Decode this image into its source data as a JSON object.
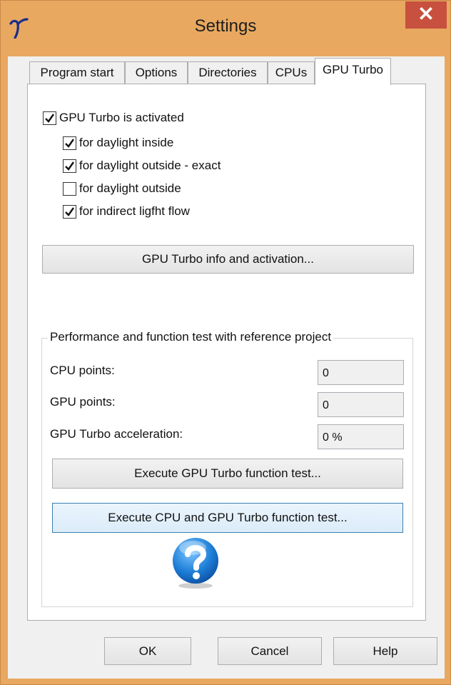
{
  "window": {
    "title": "Settings",
    "close_glyph": "✕"
  },
  "tabs": [
    {
      "label": "Program start",
      "active": false
    },
    {
      "label": "Options",
      "active": false
    },
    {
      "label": "Directories",
      "active": false
    },
    {
      "label": "CPUs",
      "active": false
    },
    {
      "label": "GPU Turbo",
      "active": true
    }
  ],
  "gpu_turbo": {
    "activated": {
      "label": "GPU Turbo is activated",
      "checked": true
    },
    "options": [
      {
        "label": "for daylight inside",
        "checked": true
      },
      {
        "label": "for daylight outside - exact",
        "checked": true
      },
      {
        "label": "for daylight outside",
        "checked": false
      },
      {
        "label": "for indirect ligfht flow",
        "checked": true
      }
    ],
    "info_button": "GPU Turbo info and activation..."
  },
  "test_group": {
    "title": "Performance and function test with reference project",
    "cpu_points_label": "CPU points:",
    "cpu_points_value": "0",
    "gpu_points_label": "GPU points:",
    "gpu_points_value": "0",
    "acceleration_label": "GPU Turbo acceleration:",
    "acceleration_value": "0 %",
    "gpu_test_button": "Execute GPU Turbo function test...",
    "cpu_gpu_test_button": "Execute CPU and GPU Turbo function test..."
  },
  "footer": {
    "ok": "OK",
    "cancel": "Cancel",
    "help": "Help"
  },
  "icons": {
    "app": "app-logo-icon",
    "help": "help-question-icon",
    "check": "checkmark-icon"
  },
  "colors": {
    "titlebar": "#e8a860",
    "close": "#c7503f",
    "focus_border": "#3c7fb1",
    "help_blue": "#1e7fd8"
  }
}
